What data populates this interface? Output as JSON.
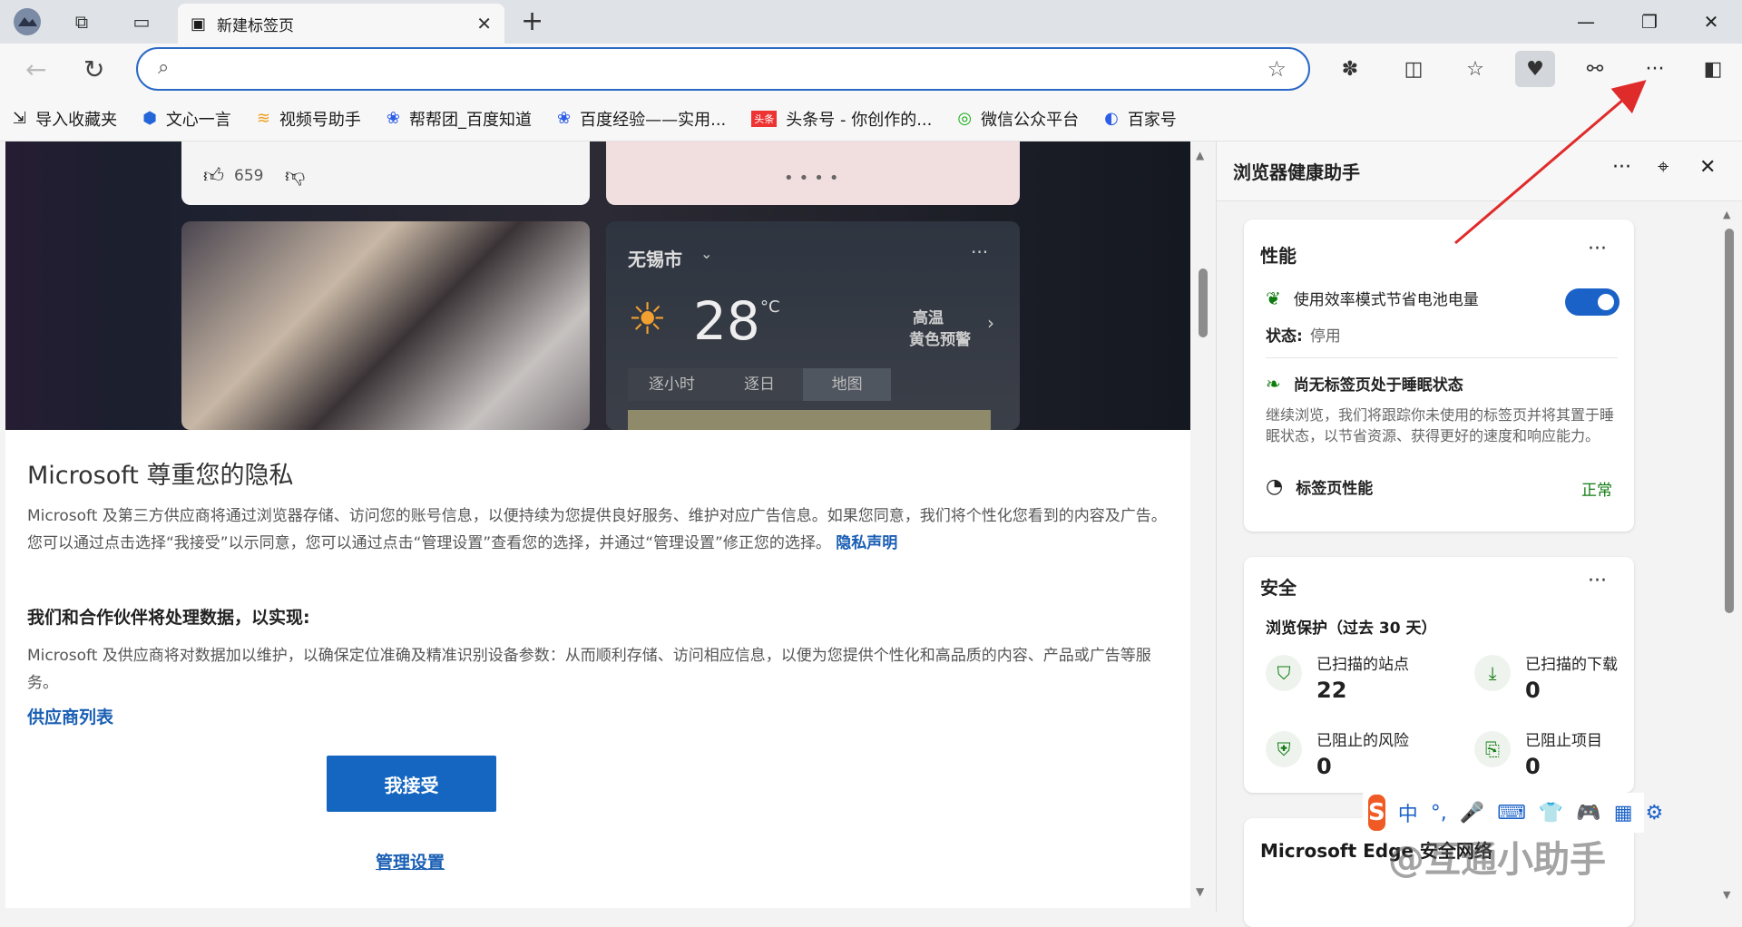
{
  "tab": {
    "title": "新建标签页"
  },
  "bookmarks": [
    {
      "label": "导入收藏夹",
      "icon": "import-icon"
    },
    {
      "label": "文心一言",
      "icon": "wenxin-icon"
    },
    {
      "label": "视频号助手",
      "icon": "video-icon"
    },
    {
      "label": "帮帮团_百度知道",
      "icon": "baidu-paw-icon"
    },
    {
      "label": "百度经验——实用...",
      "icon": "baidu-paw-icon"
    },
    {
      "label": "头条号 - 你创作的...",
      "icon": "toutiao-icon"
    },
    {
      "label": "微信公众平台",
      "icon": "wechat-icon"
    },
    {
      "label": "百家号",
      "icon": "baijia-icon"
    }
  ],
  "feed": {
    "likes": "659",
    "weather": {
      "city": "无锡市",
      "temp": "28",
      "unit": "°C",
      "alert_line1": "高温",
      "alert_line2": "黄色预警",
      "tabs": [
        "逐小时",
        "逐日",
        "地图"
      ]
    }
  },
  "privacy": {
    "title": "Microsoft 尊重您的隐私",
    "para1": "Microsoft 及第三方供应商将通过浏览器存储、访问您的账号信息，以便持续为您提供良好服务、维护对应广告信息。如果您同意，我们将个性化您看到的内容及广告。您可以通过点击选择“我接受”以示同意，您可以通过点击“管理设置”查看您的选择，并通过“管理设置”修正您的选择。",
    "privacy_link": "隐私声明",
    "heading": "我们和合作伙伴将处理数据，以实现:",
    "para2": "Microsoft 及供应商将对数据加以维护，以确保定位准确及精准识别设备参数：从而顺利存储、访问相应信息，以便为您提供个性化和高品质的内容、产品或广告等服务。",
    "vendor_link": "供应商列表",
    "accept": "我接受",
    "manage": "管理设置"
  },
  "panel": {
    "title": "浏览器健康助手",
    "performance": {
      "title": "性能",
      "efficiency_label": "使用效率模式节省电池电量",
      "status_label": "状态:",
      "status_value": "停用",
      "sleep_title": "尚无标签页处于睡眠状态",
      "sleep_desc": "继续浏览，我们将跟踪你未使用的标签页并将其置于睡眠状态，以节省资源、获得更好的速度和响应能力。",
      "tab_perf_label": "标签页性能",
      "tab_perf_value": "正常"
    },
    "security": {
      "title": "安全",
      "subtitle": "浏览保护（过去 30 天）",
      "stats": [
        {
          "label": "已扫描的站点",
          "value": "22"
        },
        {
          "label": "已扫描的下载",
          "value": "0"
        },
        {
          "label": "已阻止的风险",
          "value": "0"
        },
        {
          "label": "已阻止项目",
          "value": "0"
        }
      ]
    },
    "edge_card_title": "Microsoft Edge 安全网络"
  },
  "ime": {
    "items": [
      "中",
      "°,",
      "🎤",
      "⌨",
      "👕",
      "🎮",
      "▦",
      "⚙"
    ]
  },
  "watermark": "@互通小助手",
  "colors": {
    "accent": "#1a62c8",
    "arrow": "#e02b2b",
    "ok_green": "#107c10"
  }
}
